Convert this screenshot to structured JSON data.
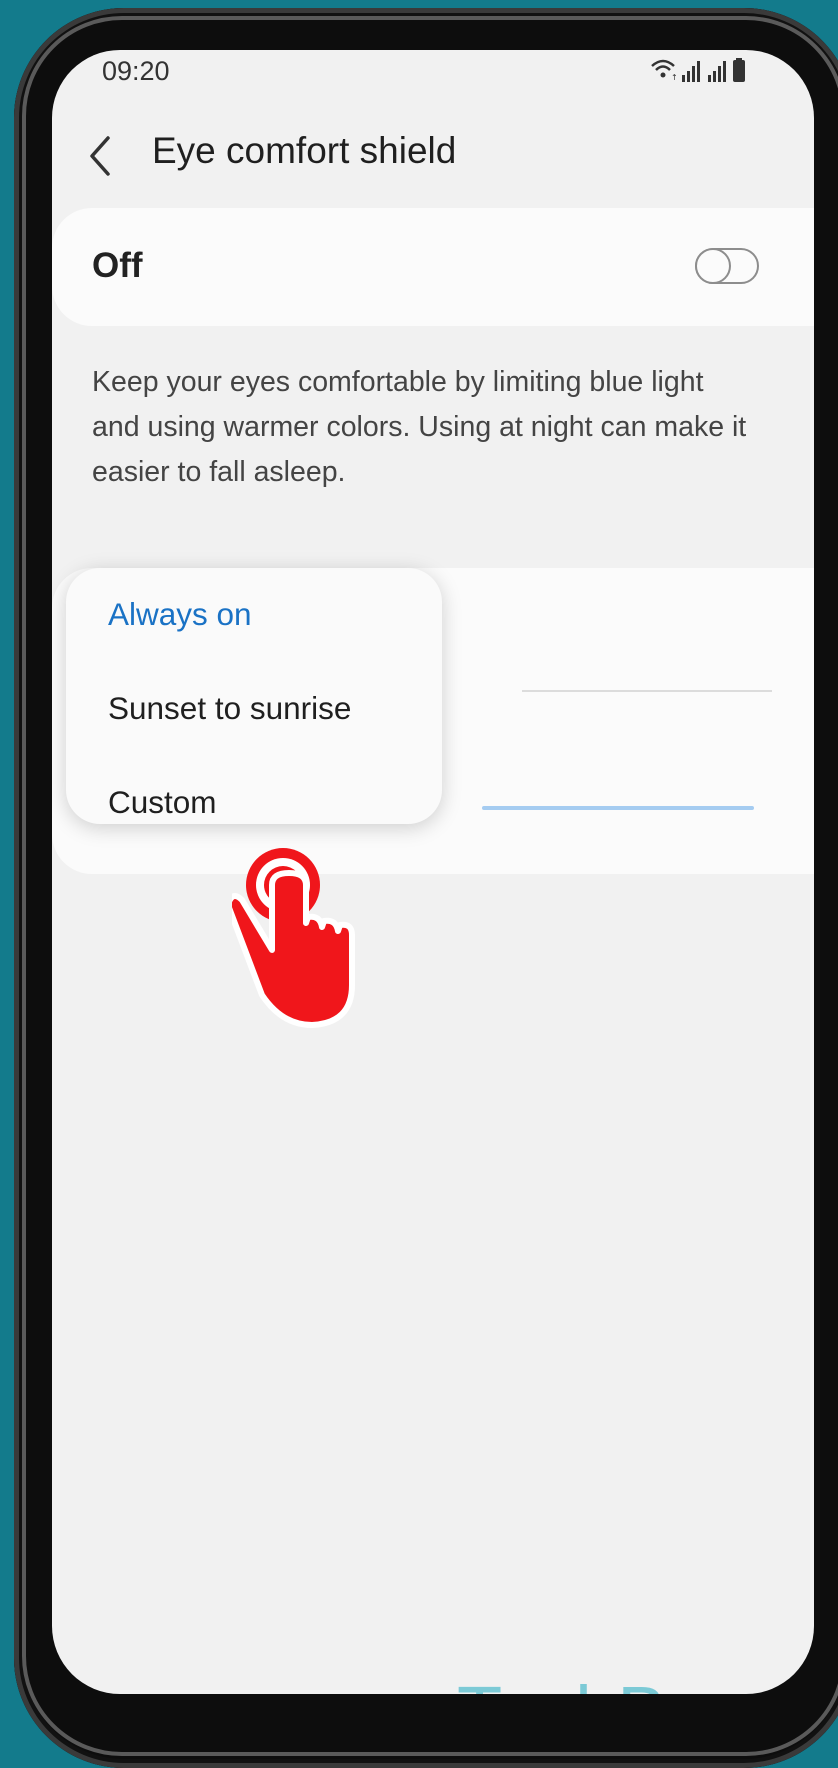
{
  "status_bar": {
    "time": "09:20",
    "icons": [
      "wifi-icon",
      "signal-icon",
      "signal-icon",
      "battery-icon"
    ]
  },
  "header": {
    "back_icon": "chevron-left-icon",
    "title": "Eye comfort shield"
  },
  "master_switch": {
    "label": "Off",
    "state": "off"
  },
  "description": "Keep your eyes comfortable by limiting blue light and using warmer colors. Using at night can make it easier to fall asleep.",
  "schedule_menu": {
    "items": [
      {
        "label": "Always on",
        "selected": true
      },
      {
        "label": "Sunset to sunrise",
        "selected": false
      },
      {
        "label": "Custom",
        "selected": false
      }
    ]
  },
  "watermark": "TechBone",
  "colors": {
    "background": "#137b8c",
    "accent": "#1a72c5",
    "tap_indicator": "#f0161b",
    "watermark": "#7ccad6"
  }
}
